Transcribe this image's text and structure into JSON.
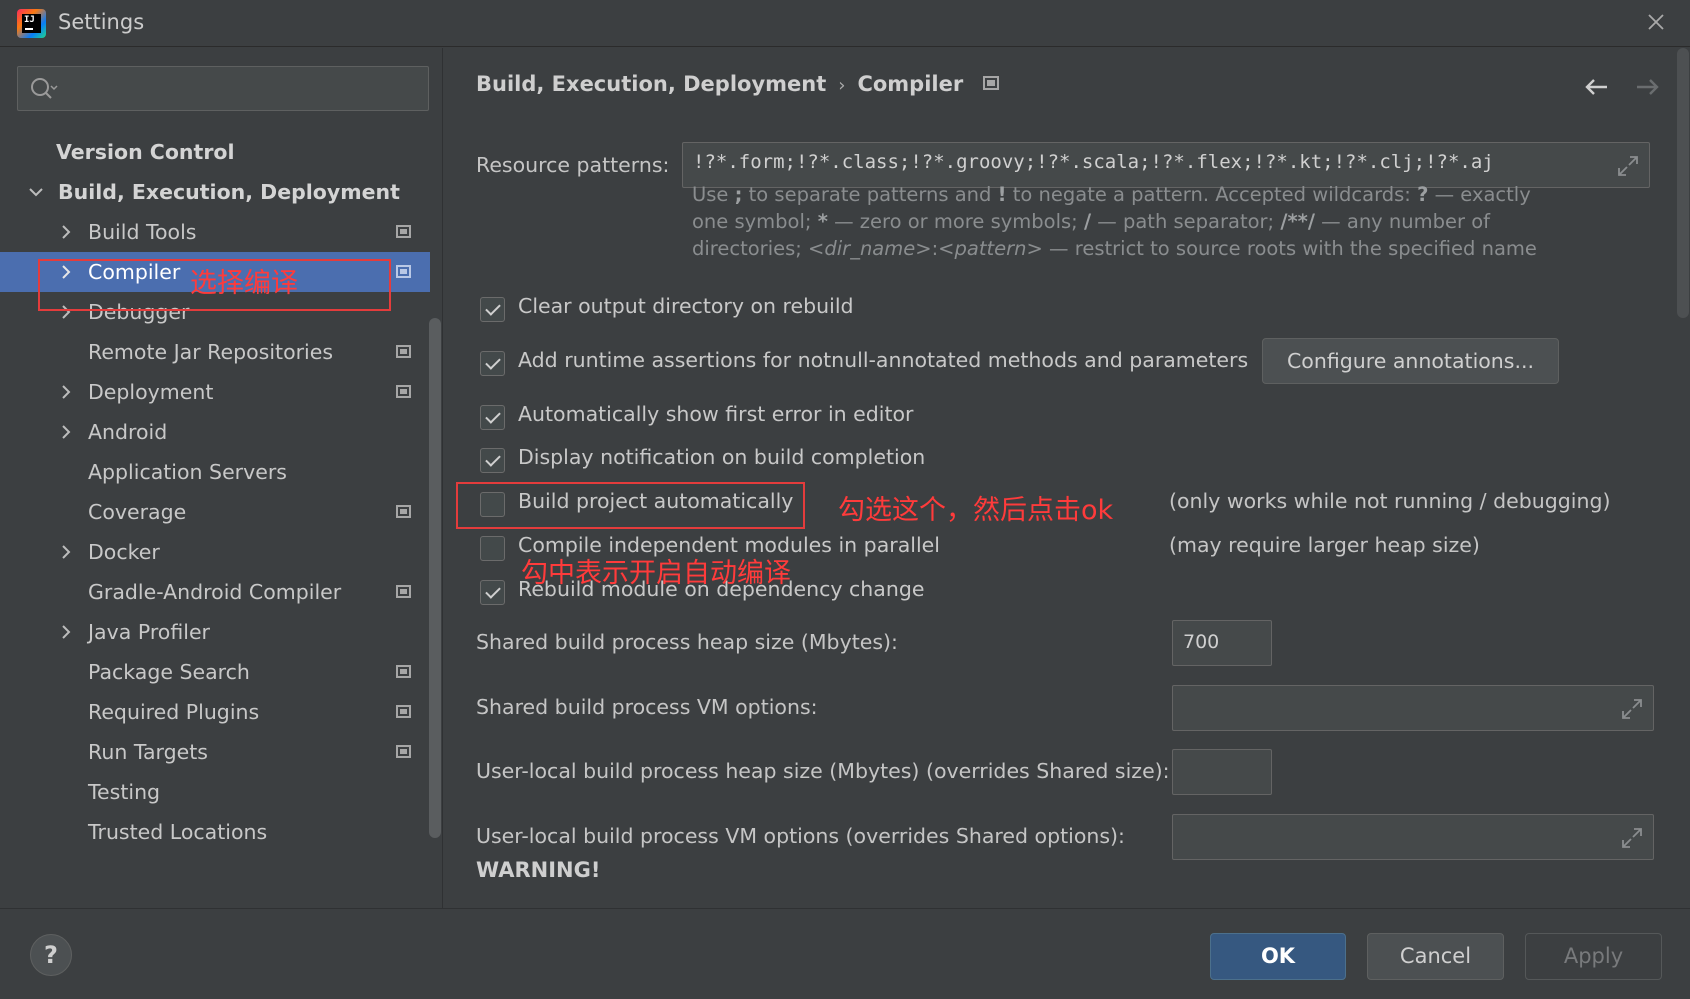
{
  "window": {
    "title": "Settings",
    "app_icon_text": "IJ"
  },
  "sidebar": {
    "search": {
      "value": "",
      "placeholder": ""
    },
    "items": [
      {
        "label": "Version Control"
      },
      {
        "label": "Build, Execution, Deployment",
        "expanded": true
      },
      {
        "label": "Build Tools"
      },
      {
        "label": "Compiler",
        "selected": true
      },
      {
        "label": "Debugger"
      },
      {
        "label": "Remote Jar Repositories"
      },
      {
        "label": "Deployment"
      },
      {
        "label": "Android"
      },
      {
        "label": "Application Servers"
      },
      {
        "label": "Coverage"
      },
      {
        "label": "Docker"
      },
      {
        "label": "Gradle-Android Compiler"
      },
      {
        "label": "Java Profiler"
      },
      {
        "label": "Package Search"
      },
      {
        "label": "Required Plugins"
      },
      {
        "label": "Run Targets"
      },
      {
        "label": "Testing"
      },
      {
        "label": "Trusted Locations"
      }
    ]
  },
  "annotations": {
    "compiler": "选择编译",
    "build_auto": "勾选这个，然后点击ok",
    "build_auto_sub": "勾中表示开启自动编译",
    "color": "#e43c3c"
  },
  "content": {
    "breadcrumb": {
      "parent": "Build, Execution, Deployment",
      "sep": "›",
      "current": "Compiler"
    },
    "resource_patterns": {
      "label": "Resource patterns:",
      "value": "!?*.form;!?*.class;!?*.groovy;!?*.scala;!?*.flex;!?*.kt;!?*.clj;!?*.aj"
    },
    "help": {
      "t1": "Use ",
      "b1": ";",
      "t2": " to separate patterns and ",
      "b2": "!",
      "t3": " to negate a pattern. Accepted wildcards: ",
      "b3": "?",
      "t4": " — exactly one symbol; ",
      "b4": "*",
      "t5": " — zero or more symbols; ",
      "b5": "/",
      "t6": " — path separator; ",
      "b6": "/**/",
      "t7": " — any number of directories; ",
      "i1": "<dir_name>",
      "t8": ":",
      "i2": "<pattern>",
      "t9": " — restrict to source roots with the specified name"
    },
    "checkboxes": [
      {
        "label": "Clear output directory on rebuild",
        "checked": true
      },
      {
        "label": "Add runtime assertions for notnull-annotated methods and parameters",
        "checked": true
      },
      {
        "label": "Automatically show first error in editor",
        "checked": true
      },
      {
        "label": "Display notification on build completion",
        "checked": true
      },
      {
        "label": "Build project automatically",
        "checked": false
      },
      {
        "label": "Compile independent modules in parallel",
        "checked": false
      },
      {
        "label": "Rebuild module on dependency change",
        "checked": true
      }
    ],
    "configure_button": "Configure annotations...",
    "notes": {
      "build_auto": "(only works while not running / debugging)",
      "parallel": "(may require larger heap size)"
    },
    "shared_heap": {
      "label": "Shared build process heap size (Mbytes):",
      "value": "700"
    },
    "shared_vm": {
      "label": "Shared build process VM options:",
      "value": ""
    },
    "user_heap": {
      "label": "User-local build process heap size (Mbytes) (overrides Shared size):",
      "value": ""
    },
    "user_vm": {
      "label": "User-local build process VM options (overrides Shared options):",
      "value": ""
    },
    "warning": "WARNING!"
  },
  "footer": {
    "help": "?",
    "ok": "OK",
    "cancel": "Cancel",
    "apply": "Apply"
  },
  "colors": {
    "selection": "#4b6eaf",
    "ok_button": "#365880",
    "background": "#3c3f41"
  }
}
